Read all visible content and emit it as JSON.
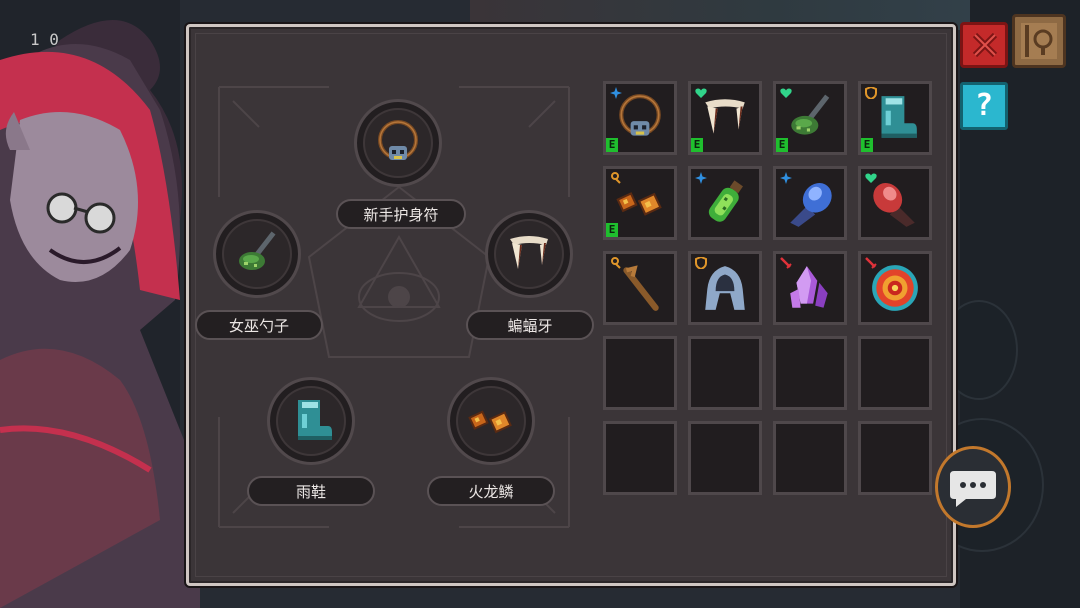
{
  "hud": {
    "value": "1 0"
  },
  "panel": {
    "equipped": [
      {
        "id": "amulet",
        "label": "新手护身符",
        "icon": "skull-amulet-icon"
      },
      {
        "id": "spoon",
        "label": "女巫勺子",
        "icon": "witch-spoon-icon"
      },
      {
        "id": "fang",
        "label": "蝙蝠牙",
        "icon": "bat-fang-icon"
      },
      {
        "id": "boots",
        "label": "雨鞋",
        "icon": "rain-boots-icon"
      },
      {
        "id": "scale",
        "label": "火龙鳞",
        "icon": "fire-dragon-scale-icon"
      }
    ],
    "inventory": [
      {
        "icon": "skull-amulet-icon",
        "tier": "blue-star",
        "equipped_tag": "E"
      },
      {
        "icon": "bat-fang-icon",
        "tier": "green-heart",
        "equipped_tag": "E"
      },
      {
        "icon": "witch-spoon-icon",
        "tier": "green-heart",
        "equipped_tag": "E"
      },
      {
        "icon": "rain-boots-icon",
        "tier": "orange-shield",
        "equipped_tag": "E"
      },
      {
        "icon": "fire-dragon-scale-icon",
        "tier": "orange-key",
        "equipped_tag": "E"
      },
      {
        "icon": "green-potion-icon",
        "tier": "blue-star",
        "equipped_tag": ""
      },
      {
        "icon": "blue-gauntlet-icon",
        "tier": "blue-star",
        "equipped_tag": ""
      },
      {
        "icon": "red-gauntlet-icon",
        "tier": "green-heart",
        "equipped_tag": ""
      },
      {
        "icon": "wooden-stick-icon",
        "tier": "orange-key",
        "equipped_tag": ""
      },
      {
        "icon": "hood-cloak-icon",
        "tier": "orange-shield",
        "equipped_tag": ""
      },
      {
        "icon": "purple-crystal-icon",
        "tier": "red-sword",
        "equipped_tag": ""
      },
      {
        "icon": "target-eye-icon",
        "tier": "red-sword",
        "equipped_tag": ""
      },
      {
        "icon": "",
        "tier": "",
        "equipped_tag": ""
      },
      {
        "icon": "",
        "tier": "",
        "equipped_tag": ""
      },
      {
        "icon": "",
        "tier": "",
        "equipped_tag": ""
      },
      {
        "icon": "",
        "tier": "",
        "equipped_tag": ""
      },
      {
        "icon": "",
        "tier": "",
        "equipped_tag": ""
      },
      {
        "icon": "",
        "tier": "",
        "equipped_tag": ""
      },
      {
        "icon": "",
        "tier": "",
        "equipped_tag": ""
      },
      {
        "icon": "",
        "tier": "",
        "equipped_tag": ""
      }
    ]
  },
  "buttons": {
    "close": {
      "icon": "close-x-icon"
    },
    "journal": {
      "icon": "journal-book-icon"
    },
    "help": {
      "icon": "question-icon",
      "label": "?"
    },
    "chat": {
      "icon": "chat-bubble-icon"
    }
  },
  "colors": {
    "panel_bg": "#3b3538",
    "panel_border": "#cfc6c2",
    "equipped_tag": "#1fbf2e",
    "close_button": "#c42a2a",
    "help_button": "#2bb7cf"
  }
}
